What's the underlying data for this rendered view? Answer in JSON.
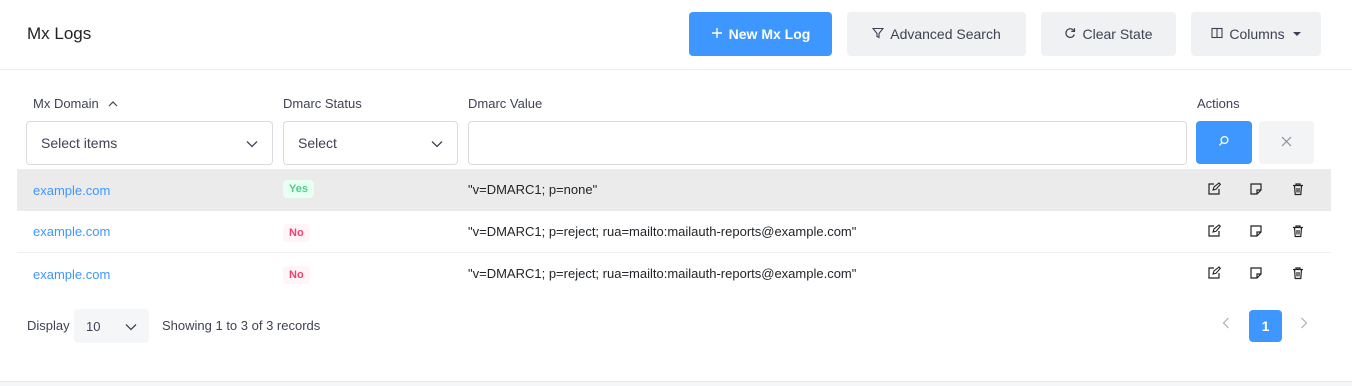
{
  "header": {
    "title": "Mx Logs",
    "new_button": "New Mx Log",
    "advanced_search_button": "Advanced Search",
    "clear_state_button": "Clear State",
    "columns_button": "Columns"
  },
  "table": {
    "columns": [
      "Mx Domain",
      "Dmarc Status",
      "Dmarc Value",
      "Actions"
    ],
    "filters": {
      "domain_placeholder": "Select items",
      "status_placeholder": "Select",
      "value_input": ""
    },
    "rows": [
      {
        "domain": "example.com",
        "status": "Yes",
        "value": "\"v=DMARC1; p=none\""
      },
      {
        "domain": "example.com",
        "status": "No",
        "value": "\"v=DMARC1; p=reject; rua=mailto:mailauth-reports@example.com\""
      },
      {
        "domain": "example.com",
        "status": "No",
        "value": "\"v=DMARC1; p=reject; rua=mailto:mailauth-reports@example.com\""
      }
    ]
  },
  "footer": {
    "display_label": "Display",
    "page_size": "10",
    "records_text": "Showing 1 to 3 of 3 records",
    "current_page": "1"
  },
  "colors": {
    "primary": "#3e97ff",
    "success": "#50cd89",
    "danger": "#f1416c"
  },
  "icons": [
    "plus-icon",
    "filter-icon",
    "refresh-icon",
    "columns-icon",
    "sort-up-icon",
    "chevron-down-icon",
    "search-icon",
    "close-icon",
    "edit-icon",
    "note-icon",
    "trash-icon",
    "chevron-left-icon",
    "chevron-right-icon"
  ]
}
